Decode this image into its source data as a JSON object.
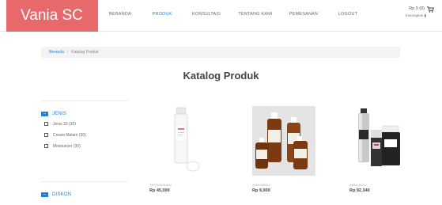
{
  "brand": {
    "name": "Vania SC"
  },
  "nav": {
    "items": [
      {
        "label": "BERANDA",
        "active": false
      },
      {
        "label": "PRODUK",
        "active": true
      },
      {
        "label": "KONSULTASI",
        "active": false
      },
      {
        "label": "TENTANG KAMI",
        "active": false
      },
      {
        "label": "PEMESANAN",
        "active": false
      },
      {
        "label": "LOGOUT",
        "active": false
      }
    ]
  },
  "cart": {
    "total": "Rp 0 (0)",
    "status": "Kosongkan",
    "icon": "cart-icon"
  },
  "breadcrumb": {
    "home": "Beranda",
    "current": "Katalog Produk"
  },
  "page": {
    "title": "Katalog Produk"
  },
  "filters": {
    "jenis": {
      "title": "JENIS",
      "options": [
        {
          "label": "Jenis 33 (30)"
        },
        {
          "label": "Cream Malam (30)"
        },
        {
          "label": "Moisturizer (30)"
        }
      ]
    },
    "diskon": {
      "title": "DISKON"
    }
  },
  "products": [
    {
      "name": "TESTIMUNIUM",
      "price": "Rp 45,000"
    },
    {
      "name": "JAMUSERU",
      "price": "Rp 9,000"
    },
    {
      "name": "ANNA BOLL",
      "price": "Rp 92,340"
    }
  ],
  "colors": {
    "brand": "#e8696b",
    "accent": "#2b7ec9",
    "amber": "#7a3a12"
  }
}
